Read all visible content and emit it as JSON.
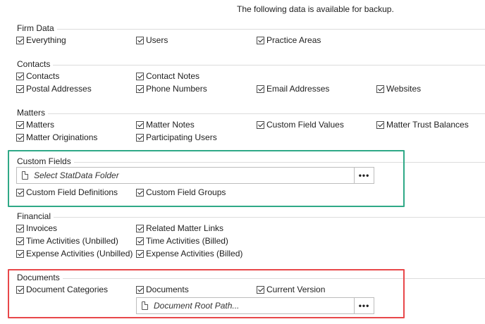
{
  "header": "The following data is available for backup.",
  "highlight_colors": {
    "custom_fields": "#2fa987",
    "documents": "#e8484a"
  },
  "firm": {
    "title": "Firm Data",
    "items": [
      "Everything",
      "Users",
      "Practice Areas"
    ]
  },
  "contacts": {
    "title": "Contacts",
    "items": [
      "Contacts",
      "Contact Notes",
      "Postal Addresses",
      "Phone Numbers",
      "Email Addresses",
      "Websites"
    ]
  },
  "matters": {
    "title": "Matters",
    "items": [
      "Matters",
      "Matter Notes",
      "Custom Field Values",
      "Matter Trust Balances",
      "Matter Originations",
      "Participating Users"
    ]
  },
  "custom": {
    "title": "Custom Fields",
    "folder_placeholder": "Select StatData Folder",
    "browse_label": "•••",
    "items": [
      "Custom Field Definitions",
      "Custom Field Groups"
    ]
  },
  "financial": {
    "title": "Financial",
    "items": [
      "Invoices",
      "Related Matter Links",
      "Time Activities (Unbilled)",
      "Time Activities (Billed)",
      "Expense Activities (Unbilled)",
      "Expense Activities (Billed)"
    ]
  },
  "documents": {
    "title": "Documents",
    "items": [
      "Document Categories",
      "Documents",
      "Current Version"
    ],
    "root_placeholder": "Document Root Path...",
    "browse_label": "•••"
  }
}
